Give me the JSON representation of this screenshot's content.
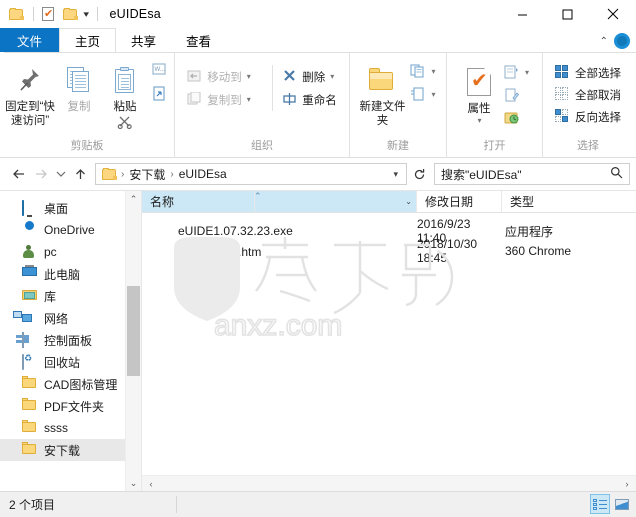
{
  "window": {
    "title": "eUIDEsa",
    "quick_access": [
      {
        "name": "folder-icon",
        "label": "新建文件夹"
      },
      {
        "name": "properties-icon",
        "label": "属性"
      },
      {
        "name": "folder-icon",
        "label": "文件夹"
      },
      {
        "name": "chevron-down-icon",
        "label": "自定义快速访问工具栏"
      }
    ],
    "controls": {
      "minimize": "—",
      "maximize": "□",
      "close": "✕"
    }
  },
  "tabs": [
    {
      "label": "文件",
      "active": false,
      "kind": "file"
    },
    {
      "label": "主页",
      "active": true,
      "kind": "normal"
    },
    {
      "label": "共享",
      "active": false,
      "kind": "normal"
    },
    {
      "label": "查看",
      "active": false,
      "kind": "normal"
    }
  ],
  "ribbon": {
    "collapse_icon": "chevron-up-icon",
    "help_icon": "help-circle-icon",
    "groups": [
      {
        "label": "剪贴板",
        "big_buttons": [
          {
            "label": "固定到“快速访问”",
            "icon": "pin-icon",
            "disabled": false
          },
          {
            "label": "复制",
            "icon": "copy-icon",
            "disabled": true
          },
          {
            "label": "粘贴",
            "icon": "paste-icon",
            "disabled": false
          }
        ],
        "small_buttons": [
          {
            "label": "剪切",
            "icon": "scissors-icon"
          },
          {
            "label": "复制路径",
            "icon": "copy-path-icon"
          },
          {
            "label": "粘贴快捷方式",
            "icon": "paste-shortcut-icon"
          }
        ]
      },
      {
        "label": "组织",
        "small_buttons": [
          {
            "label": "移动到",
            "icon": "move-to-icon",
            "caret": true,
            "disabled": true
          },
          {
            "label": "删除",
            "icon": "delete-x-icon",
            "caret": true,
            "disabled": false
          },
          {
            "label": "复制到",
            "icon": "copy-to-icon",
            "caret": true,
            "disabled": true
          },
          {
            "label": "重命名",
            "icon": "rename-icon",
            "caret": false,
            "disabled": false
          }
        ]
      },
      {
        "label": "新建",
        "big_buttons": [
          {
            "label": "新建文件夹",
            "icon": "new-folder-icon",
            "disabled": false
          }
        ],
        "small_buttons": [
          {
            "label": "新建项目",
            "icon": "new-item-icon",
            "caret": true
          },
          {
            "label": "轻松访问",
            "icon": "easy-access-icon",
            "caret": true
          }
        ]
      },
      {
        "label": "打开",
        "big_buttons": [
          {
            "label": "属性",
            "icon": "properties-icon",
            "disabled": false
          }
        ],
        "small_buttons": [
          {
            "label": "打开",
            "icon": "open-icon",
            "caret": true
          },
          {
            "label": "编辑",
            "icon": "edit-icon",
            "caret": false
          },
          {
            "label": "历史记录",
            "icon": "history-icon",
            "caret": false
          }
        ]
      },
      {
        "label": "选择",
        "small_buttons": [
          {
            "label": "全部选择",
            "icon": "select-all-icon"
          },
          {
            "label": "全部取消",
            "icon": "select-none-icon"
          },
          {
            "label": "反向选择",
            "icon": "invert-selection-icon"
          }
        ]
      }
    ]
  },
  "addressbar": {
    "back_icon": "arrow-left-icon",
    "forward_icon": "arrow-right-icon",
    "recent_icon": "chevron-down-icon",
    "up_icon": "arrow-up-icon",
    "path_icon": "folder-icon",
    "crumbs": [
      "安下载",
      "eUIDEsa"
    ],
    "crumb_separator": "›",
    "dropdown_icon": "chevron-down-icon",
    "refresh_icon": "refresh-icon"
  },
  "search": {
    "placeholder": "搜索\"eUIDEsa\"",
    "icon": "search-icon"
  },
  "navpane": {
    "items": [
      {
        "label": "桌面",
        "icon": "desktop-icon",
        "selected": false
      },
      {
        "label": "OneDrive",
        "icon": "onedrive-cloud-icon",
        "selected": false
      },
      {
        "label": "pc",
        "icon": "user-icon",
        "selected": false
      },
      {
        "label": "此电脑",
        "icon": "this-pc-icon",
        "selected": false
      },
      {
        "label": "库",
        "icon": "library-icon",
        "selected": false
      },
      {
        "label": "网络",
        "icon": "network-icon",
        "selected": false
      },
      {
        "label": "控制面板",
        "icon": "control-panel-icon",
        "selected": false
      },
      {
        "label": "回收站",
        "icon": "recycle-bin-icon",
        "selected": false
      },
      {
        "label": "CAD图标管理",
        "icon": "folder-icon",
        "selected": false
      },
      {
        "label": "PDF文件夹",
        "icon": "folder-icon",
        "selected": false
      },
      {
        "label": "ssss",
        "icon": "folder-icon",
        "selected": false
      },
      {
        "label": "安下载",
        "icon": "folder-icon",
        "selected": true
      }
    ],
    "scroll_up_icon": "chevron-up-icon",
    "scroll_down_icon": "chevron-down-icon"
  },
  "filelist": {
    "columns": [
      {
        "label": "名称",
        "sorted": "asc"
      },
      {
        "label": "修改日期",
        "sorted": null
      },
      {
        "label": "类型",
        "sorted": null
      }
    ],
    "sort_icon": "sort-ascending-icon",
    "header_caret_icon": "chevron-down-icon",
    "rows": [
      {
        "name": "eUIDE1.07.32.23.exe",
        "date": "2016/9/23 11:40",
        "type": "应用程序",
        "icon": "download-globe-icon"
      },
      {
        "name": "安下载帮助.htm",
        "date": "2018/10/30 18:45",
        "type": "360 Chrome",
        "icon": "chrome-360-icon"
      }
    ],
    "watermark": {
      "text": "安下载",
      "site": "anxz.com"
    }
  },
  "statusbar": {
    "item_count": "2 个项目",
    "views": [
      {
        "name": "details-view-button",
        "icon": "details-view-icon",
        "active": true
      },
      {
        "name": "large-icons-view-button",
        "icon": "large-icons-view-icon",
        "active": false
      }
    ]
  },
  "colors": {
    "accent": "#0b74c4",
    "selection": "#cce8f6",
    "folder": "#fbd77c"
  }
}
